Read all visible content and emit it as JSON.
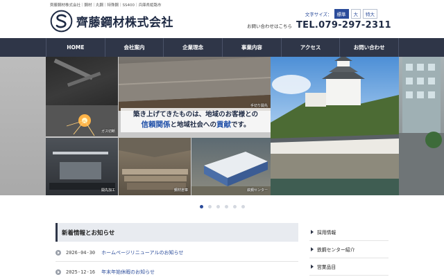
{
  "header": {
    "tagline": "齊藤鋼材株式会社｜鋼材｜丸鋼｜特殊鋼｜SS400｜兵庫県姫路市",
    "company_name": "齊藤鋼材株式会社",
    "fontsize_label": "文字サイズ：",
    "fontsize_options": [
      "標準",
      "大",
      "特大"
    ],
    "contact_label": "お問い合わせはこちら",
    "phone": "TEL.079-297-2311"
  },
  "nav": {
    "items": [
      "HOME",
      "会社案内",
      "企業理念",
      "事業内容",
      "アクセス",
      "お問い合わせ"
    ]
  },
  "hero": {
    "caption_line1": "築き上げてきたものは、地域のお客様との",
    "caption_hl1": "信頼関係",
    "caption_mid": "と地域社会への",
    "caption_hl2": "貢献",
    "caption_end": "です。",
    "labels": {
      "gas_cutting": "ガス切断",
      "hand_cutting": "手切り開先",
      "beveling": "開先加工",
      "steel_warehouse": "鋼材倉庫",
      "steel_center": "鉄鋼センター"
    },
    "slide_count": 6,
    "active_slide": 1
  },
  "news": {
    "title": "新着情報とお知らせ",
    "items": [
      {
        "date": "2026-04-30",
        "text": "ホームページリニューアルのお知らせ"
      },
      {
        "date": "2025-12-16",
        "text": "年末年始休暇のお知らせ"
      }
    ]
  },
  "side_menu": {
    "items": [
      "採用情報",
      "鉄鋼センター紹介",
      "営業品目"
    ]
  },
  "colors": {
    "nav_bg": "#2f3648",
    "brand_navy": "#1e2a44",
    "link_blue": "#2a4b9a"
  }
}
